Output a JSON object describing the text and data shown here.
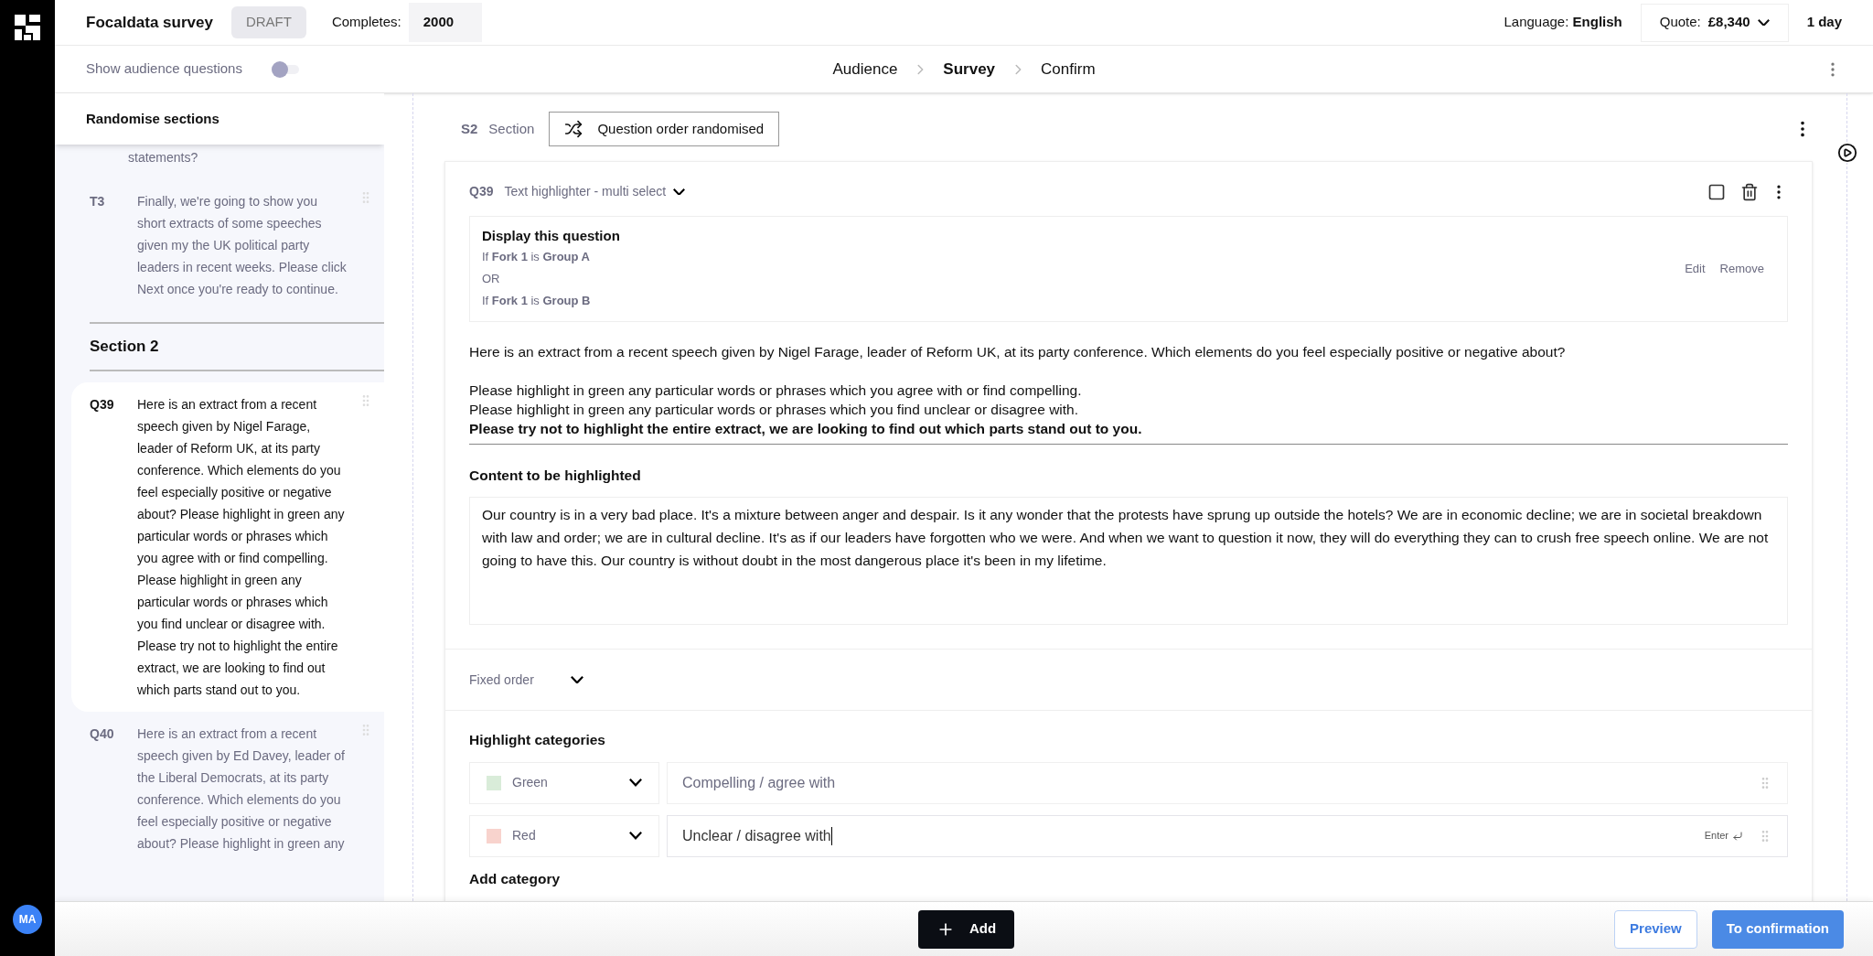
{
  "app": {
    "title": "Focaldata survey",
    "status": "DRAFT",
    "completes_label": "Completes:",
    "completes_value": "2000",
    "language_label": "Language:",
    "language_value": "English",
    "quote_label": "Quote:",
    "quote_value": "£8,340",
    "turnaround": "1 day",
    "user_initials": "MA"
  },
  "subbar": {
    "toggle_label": "Show audience questions",
    "toggle_on": false
  },
  "steps": [
    {
      "label": "Audience",
      "selected": false
    },
    {
      "label": "Survey",
      "selected": true
    },
    {
      "label": "Confirm",
      "selected": false
    }
  ],
  "sidebar": {
    "menu_item": "Randomise sections",
    "cut_text": "statements?",
    "section_title": "Section 2",
    "items": [
      {
        "code": "T3",
        "text": "Finally, we're going to show you short extracts of some speeches given my the UK political party leaders in recent weeks. Please click Next once you're ready to continue.",
        "selected": false
      },
      {
        "code": "Q39",
        "text": "Here is an extract from a recent speech given by Nigel Farage, leader of Reform UK, at its party conference. Which elements do you feel especially positive or negative about? Please highlight in green any particular words or phrases which you agree with or find compelling. Please highlight in green any particular words or phrases which you find unclear or disagree with. Please try not to highlight the entire extract, we are looking to find out which parts stand out to you.",
        "selected": true
      },
      {
        "code": "Q40",
        "text": "Here is an extract from a recent speech given by Ed Davey, leader of the Liberal Democrats, at its party conference. Which elements do you feel especially positive or negative about? Please highlight in green any",
        "selected": false
      }
    ]
  },
  "section": {
    "code": "S2",
    "label": "Section",
    "order_button": "Question order randomised"
  },
  "question": {
    "code": "Q39",
    "type": "Text highlighter - multi select",
    "display": {
      "title": "Display this question",
      "conditions": [
        "If **Fork 1** is **Group A**",
        "OR",
        "If **Fork 1** is **Group B**"
      ],
      "edit": "Edit",
      "remove": "Remove"
    },
    "intro": "Here is an extract from a recent speech given by Nigel Farage, leader of Reform UK, at its party conference. Which elements do you feel especially positive or negative about?",
    "text_lines": [
      "Please highlight in green any particular words or phrases which you agree with or find compelling.",
      "Please highlight in green any particular words or phrases which you find unclear or disagree with.",
      "**Please try not to highlight the entire extract, we are looking to find out which parts stand out to you.**"
    ],
    "content_title": "Content to be highlighted",
    "content": "Our country is in a very bad place. It's a mixture between anger and despair. Is it any wonder that the protests have sprung up outside the hotels? We are in economic decline; we are in societal breakdown with law and order; we are in cultural decline. It's as if our leaders have forgotten who we were. And when we want to question it now, they will do everything they can to crush free speech online. We are not going to have this. Our country is without doubt in the most dangerous place it's been in my lifetime.",
    "order": "Fixed order",
    "categories_title": "Highlight categories",
    "categories": [
      {
        "color_name": "Green",
        "color": "#d9ecd9",
        "value": "Compelling / agree with",
        "focused": false
      },
      {
        "color_name": "Red",
        "color": "#f8d3cd",
        "value": "Unclear / disagree with",
        "focused": true
      }
    ],
    "enter_hint": "Enter",
    "add_category": "Add category"
  },
  "footer": {
    "add": "Add",
    "preview": "Preview",
    "confirm": "To confirmation"
  }
}
